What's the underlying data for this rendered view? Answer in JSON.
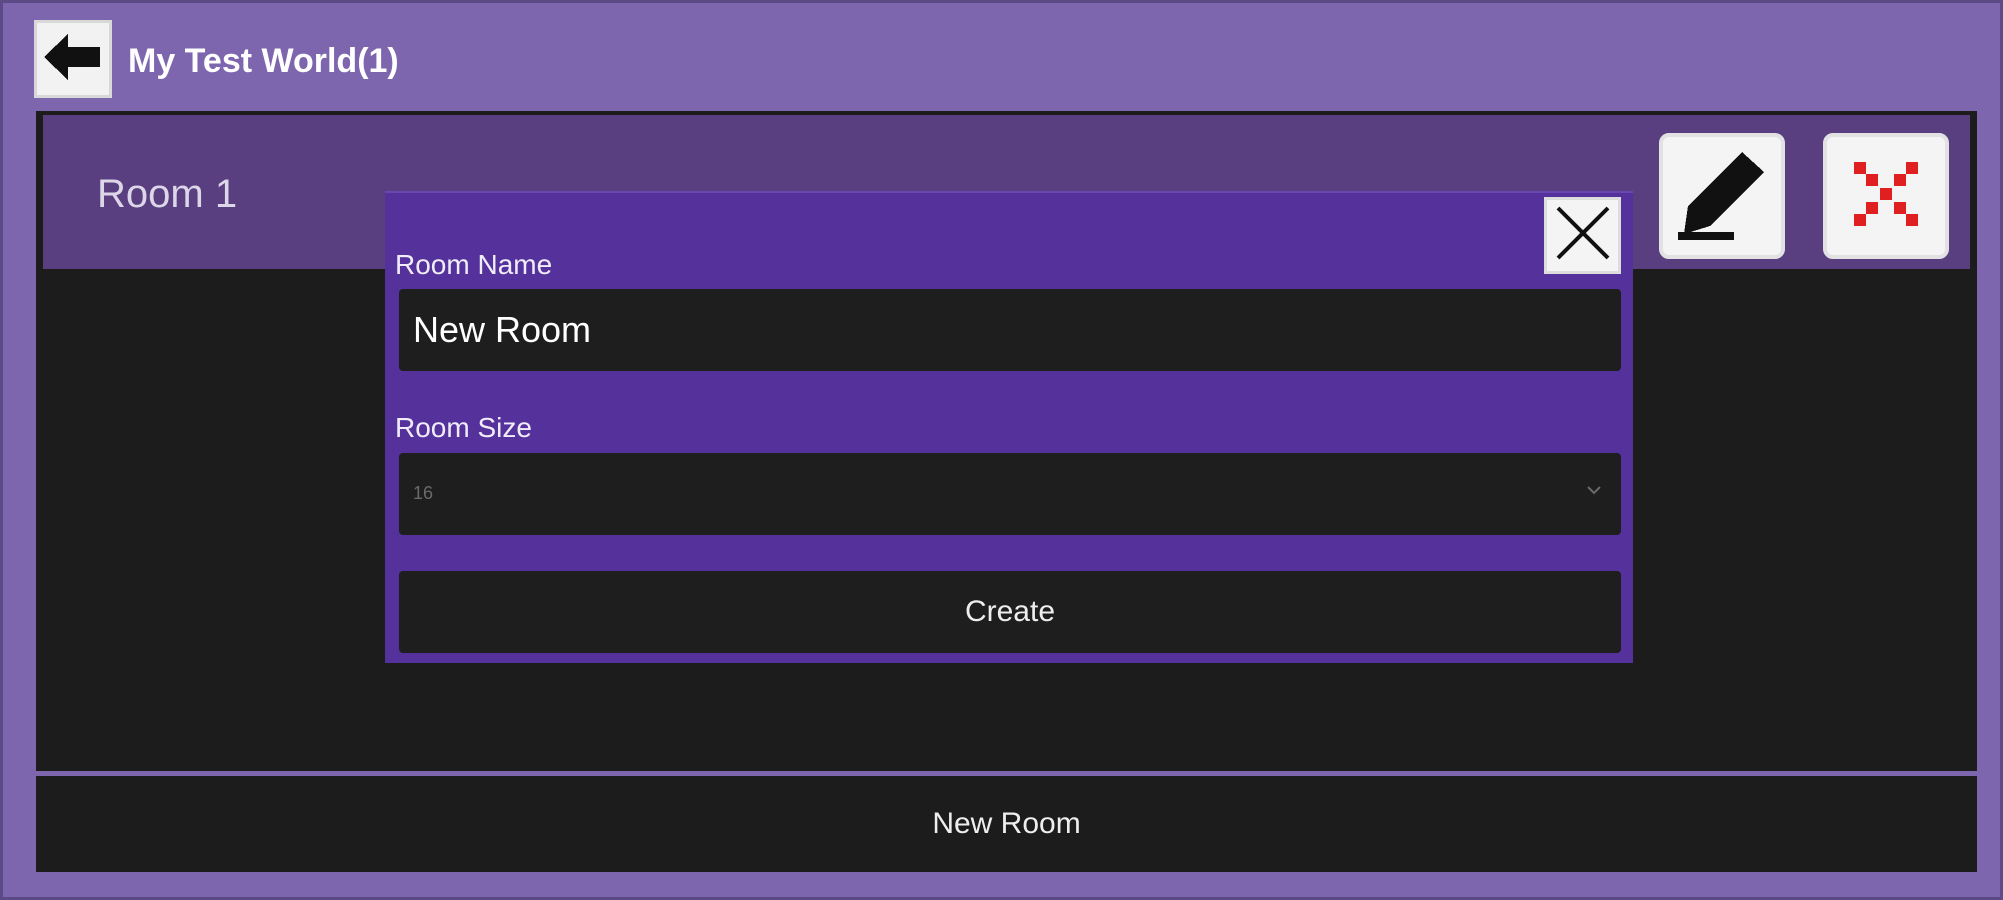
{
  "header": {
    "title": "My Test World(1)",
    "back_icon": "arrow-left-icon"
  },
  "rooms": [
    {
      "name": "Room 1",
      "edit_icon": "pencil-icon",
      "delete_icon": "close-x-icon"
    }
  ],
  "modal": {
    "close_icon": "close-icon",
    "room_name_label": "Room Name",
    "room_name_value": "New Room",
    "room_size_label": "Room Size",
    "room_size_value": "16",
    "create_label": "Create"
  },
  "footer": {
    "new_room_label": "New Room"
  },
  "colors": {
    "background": "#7e66ae",
    "panel": "#1c1c1c",
    "room_row": "#593e80",
    "modal": "#55319c",
    "delete_accent": "#e02020"
  }
}
